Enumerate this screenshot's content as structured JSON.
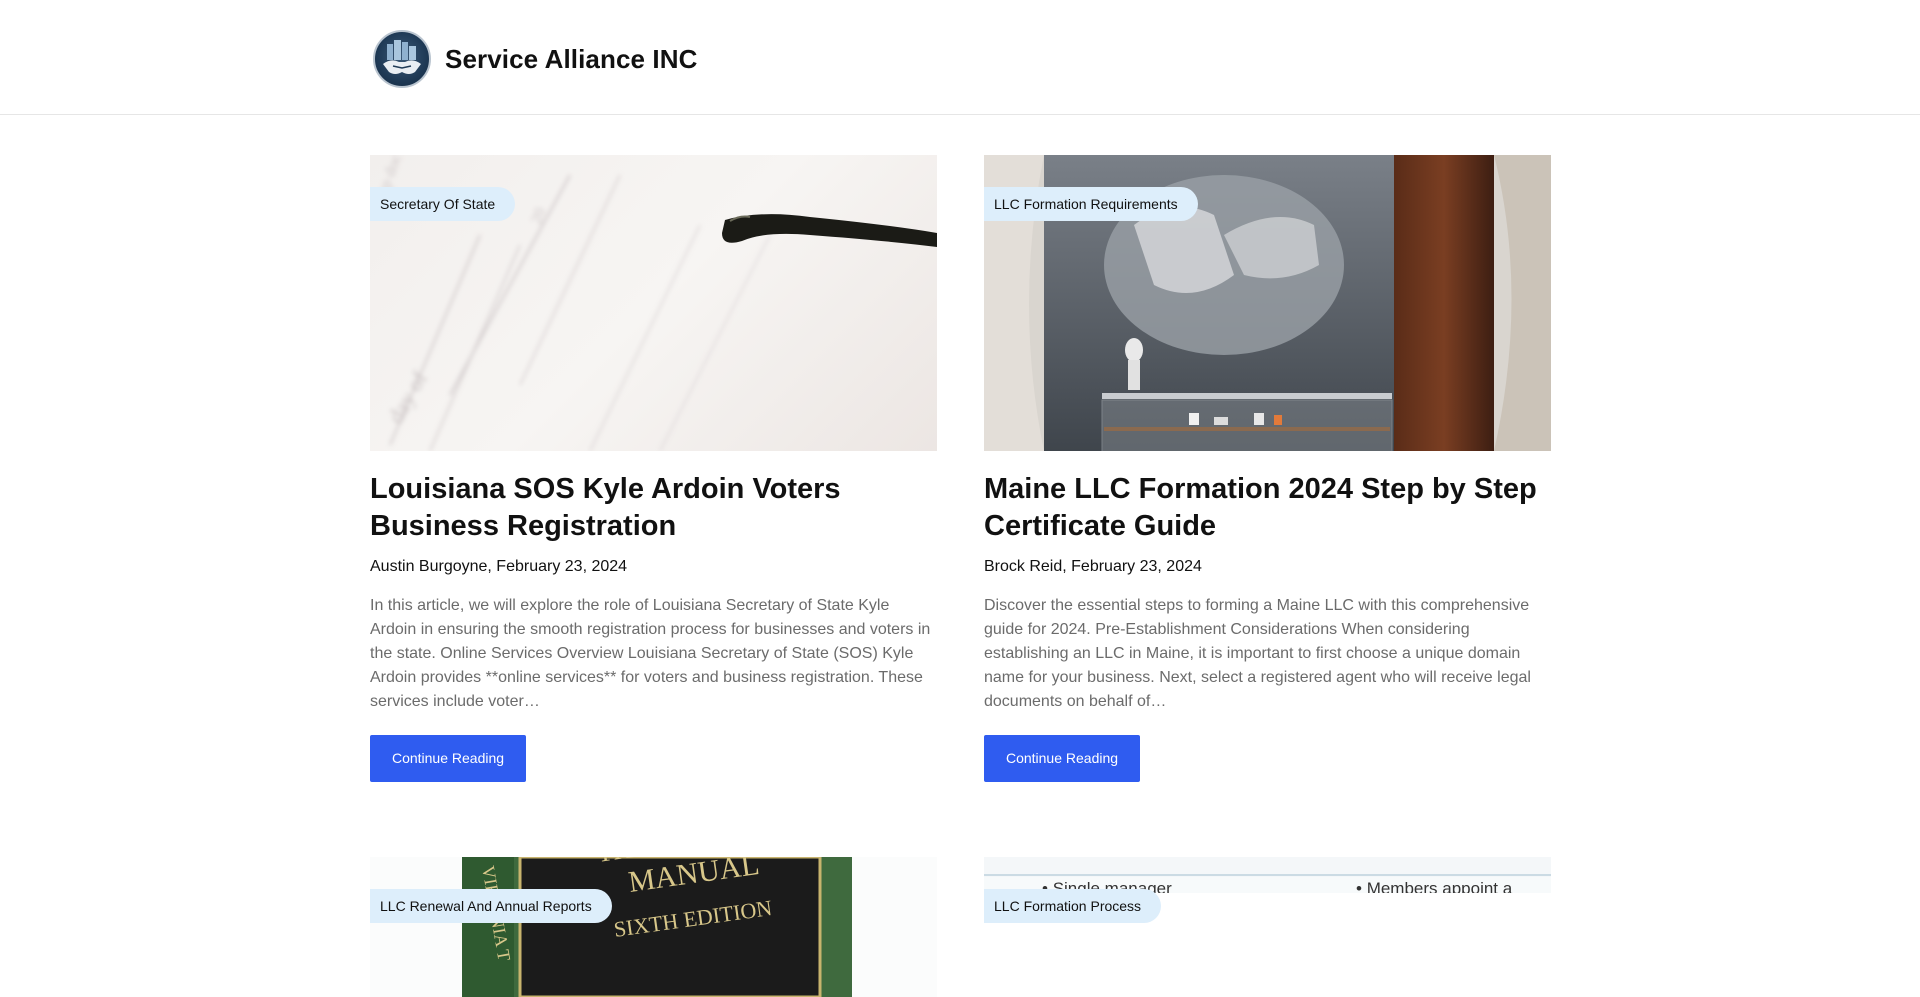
{
  "site": {
    "title": "Service Alliance INC",
    "logo_icon": "handshake-city-logo-icon"
  },
  "posts": [
    {
      "category": "Secretary Of State",
      "title": "Louisiana SOS Kyle Ardoin Voters Business Registration",
      "author": "Austin Burgoyne",
      "date": "February 23, 2024",
      "meta": "Austin Burgoyne, February 23, 2024",
      "excerpt": "In this article, we will explore the role of Louisiana Secretary of State Kyle Ardoin in ensuring the smooth registration process for businesses and voters in the state. Online Services Overview Louisiana Secretary of State (SOS) Kyle Ardoin provides **online services** for voters and business registration. These services include voter…",
      "button": "Continue Reading",
      "image_icon": "document-glasses-photo"
    },
    {
      "category": "LLC Formation Requirements",
      "title": "Maine LLC Formation 2024 Step by Step Certificate Guide",
      "author": "Brock Reid",
      "date": "February 23, 2024",
      "meta": "Brock Reid, February 23, 2024",
      "excerpt": "Discover the essential steps to forming a Maine LLC with this comprehensive guide for 2024. Pre-Establishment Considerations When considering establishing an LLC in Maine, it is important to first choose a unique domain name for your business. Next, select a registered agent who will receive legal documents on behalf of…",
      "button": "Continue Reading",
      "image_icon": "sculpture-gallery-photo"
    },
    {
      "category": "LLC Renewal And Annual Reports",
      "image_icon": "title-manual-book-photo"
    },
    {
      "category": "LLC Formation Process",
      "image_icon": "comparison-table-photo",
      "image_text": {
        "left": "Single manager",
        "right": "Members appoint a"
      }
    }
  ],
  "colors": {
    "accent": "#2f5cf0",
    "badge_bg": "#ddeefb",
    "excerpt": "#6b6b6b"
  }
}
